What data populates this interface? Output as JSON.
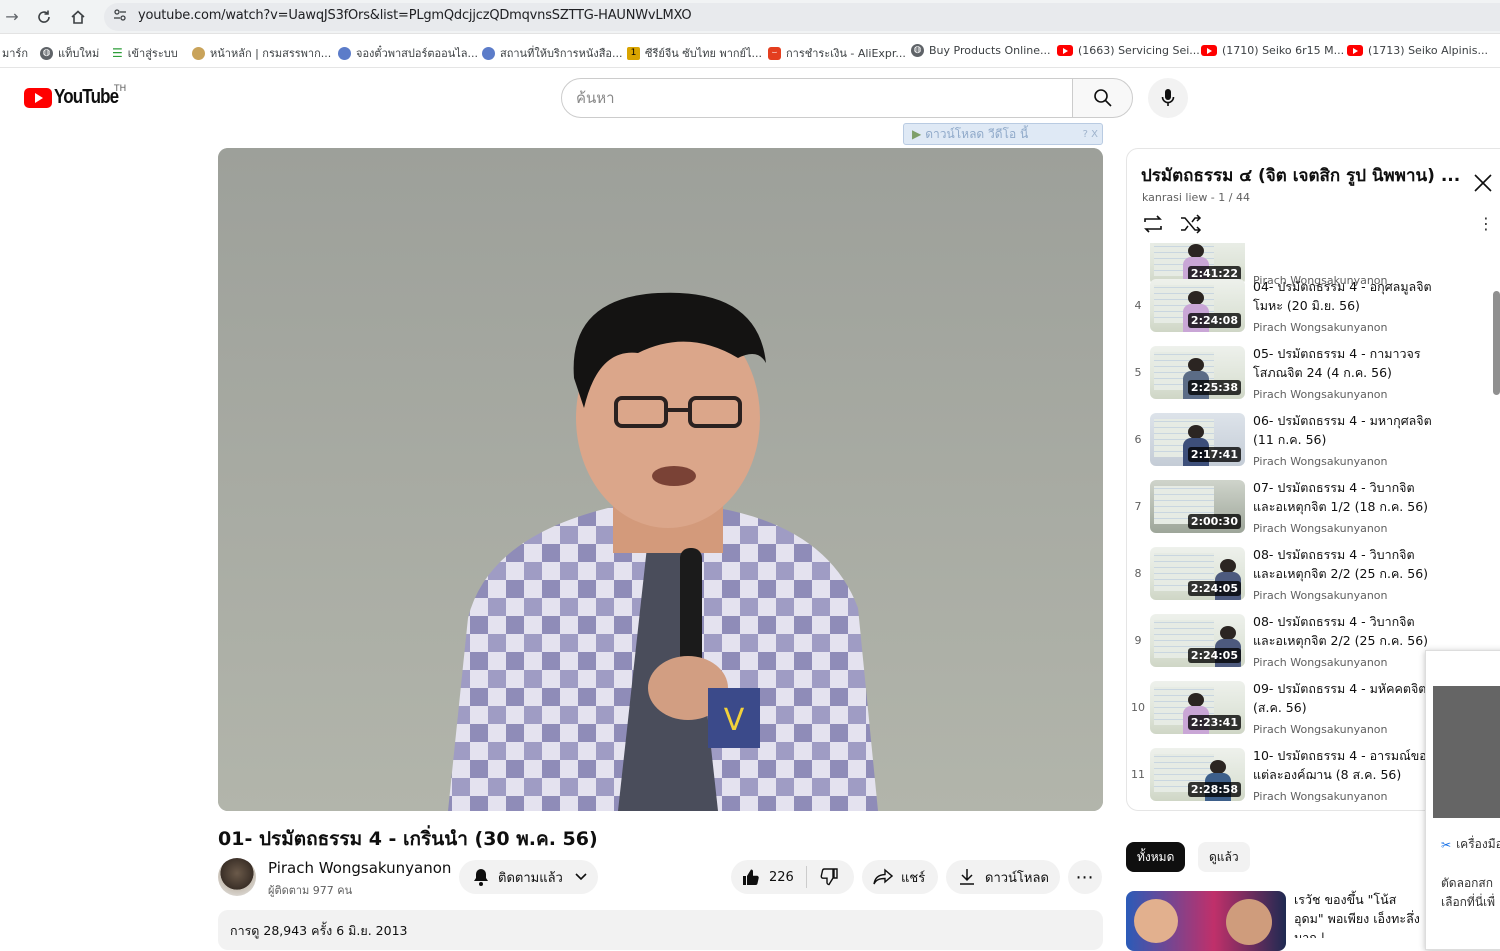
{
  "browser": {
    "url": "youtube.com/watch?v=UawqJS3fOrs&list=PLgmQdcjjczQDmqvnsSZTTG-HAUNWvLMXO"
  },
  "bookmarks": [
    {
      "label": "มาร์ก",
      "icon": "none"
    },
    {
      "label": "แท็บใหม่",
      "icon": "globe-icon"
    },
    {
      "label": "เข้าสู่ระบบ",
      "icon": "green-menu-icon"
    },
    {
      "label": "หน้าหลัก | กรมสรรพาก...",
      "icon": "seal-icon"
    },
    {
      "label": "จองตั๋วพาสปอร์ตออนไล...",
      "icon": "blue-seal-icon"
    },
    {
      "label": "สถานที่ให้บริการหนังสือ...",
      "icon": "blue-seal-icon"
    },
    {
      "label": "ซีรีย์จีน ซับไทย พากย์ไ...",
      "icon": "yellow-box-icon"
    },
    {
      "label": "การชำระเงิน - AliExpr...",
      "icon": "aliexpress-icon"
    },
    {
      "label": "Buy Products Online...",
      "icon": "globe-icon"
    },
    {
      "label": "(1663) Servicing Sei...",
      "icon": "youtube-icon"
    },
    {
      "label": "(1710) Seiko 6r15 M...",
      "icon": "youtube-icon"
    },
    {
      "label": "(1713) Seiko Alpinis...",
      "icon": "youtube-icon"
    }
  ],
  "header": {
    "logo_text": "YouTube",
    "country": "TH",
    "search_placeholder": "ค้นหา"
  },
  "extension": {
    "label": "ดาวน์โหลด วีดีโอ นี้",
    "help": "? X"
  },
  "video": {
    "title": "01- ปรมัตถธรรม 4 - เกริ่นนำ (30 พ.ค. 56)",
    "channel": "Pirach Wongsakunyanon",
    "subscribers": "ผู้ติดตาม 977 คน",
    "subscribed_label": "ติดตามแล้ว",
    "likes": "226",
    "share_label": "แชร์",
    "download_label": "ดาวน์โหลด",
    "views_date": "การดู 28,943 ครั้ง  6 มิ.ย. 2013"
  },
  "playlist": {
    "title": "ปรมัตถธรรม ๔ (จิต เจตสิก รูป นิพพาน) ...",
    "subtitle": "kanrasi liew - 1 / 44",
    "items": [
      {
        "index": "",
        "duration": "2:41:22",
        "title": "",
        "channel": "Pirach Wongsakunyanon"
      },
      {
        "index": "4",
        "duration": "2:24:08",
        "title": "04- ปรมัตถธรรม 4 - อกุศลมูลจิต โมหะ (20 มิ.ย. 56)",
        "channel": "Pirach Wongsakunyanon"
      },
      {
        "index": "5",
        "duration": "2:25:38",
        "title": "05- ปรมัตถธรรม 4 - กามาวจรโสภณจิต 24 (4 ก.ค. 56)",
        "channel": "Pirach Wongsakunyanon"
      },
      {
        "index": "6",
        "duration": "2:17:41",
        "title": "06- ปรมัตถธรรม 4 - มหากุศลจิต (11 ก.ค. 56)",
        "channel": "Pirach Wongsakunyanon"
      },
      {
        "index": "7",
        "duration": "2:00:30",
        "title": "07- ปรมัตถธรรม 4 - วิบากจิต และอเหตุกจิต 1/2 (18 ก.ค. 56)",
        "channel": "Pirach Wongsakunyanon"
      },
      {
        "index": "8",
        "duration": "2:24:05",
        "title": "08- ปรมัตถธรรม 4 - วิบากจิต และอเหตุกจิต 2/2 (25 ก.ค. 56)",
        "channel": "Pirach Wongsakunyanon"
      },
      {
        "index": "9",
        "duration": "2:24:05",
        "title": "08- ปรมัตถธรรม 4 - วิบากจิต และอเหตุกจิต 2/2 (25 ก.ค. 56)",
        "channel": "Pirach Wongsakunyanon"
      },
      {
        "index": "10",
        "duration": "2:23:41",
        "title": "09- ปรมัตถธรรม 4 - มหัคคตจิต (ส.ค. 56)",
        "channel": "Pirach Wongsakunyanon"
      },
      {
        "index": "11",
        "duration": "2:28:58",
        "title": "10- ปรมัตถธรรม 4 - อารมณ์ของแต่ละองค์ฌาน (8 ส.ค. 56)",
        "channel": "Pirach Wongsakunyanon"
      }
    ]
  },
  "chips": {
    "all": "ทั้งหมด",
    "watched": "ดูแล้ว"
  },
  "recommendation": {
    "title": "เรวัช ของขึ้น \"โน้ส อุดม\" พอเพียง เอ็งทะลึ่งมาก | ..."
  },
  "popup": {
    "line1": "เครื่องมือ",
    "line2": "ตัดลอกสก",
    "line3": "เลือกที่นี่เพื่"
  }
}
